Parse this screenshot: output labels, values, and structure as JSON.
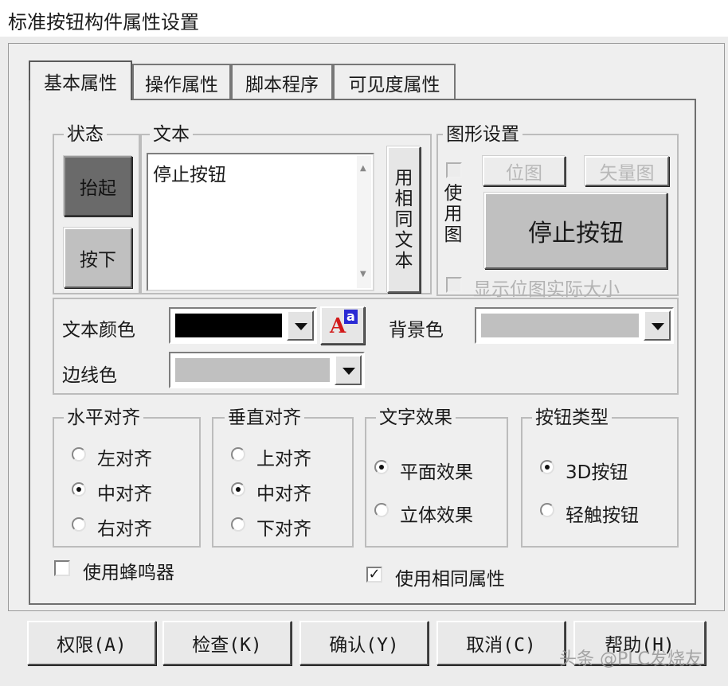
{
  "window": {
    "title": "标准按钮构件属性设置"
  },
  "tabs": [
    "基本属性",
    "操作属性",
    "脚本程序",
    "可见度属性"
  ],
  "state_group": {
    "label": "状态",
    "up": "抬起",
    "down": "按下"
  },
  "text_group": {
    "label": "文本",
    "value": "停止按钮",
    "same_text_button": "用相同文本"
  },
  "graphic_group": {
    "label": "图形设置",
    "use_image": "使用图",
    "bitmap_button": "位图",
    "vector_button": "矢量图",
    "preview_text": "停止按钮",
    "show_actual_size": "显示位图实际大小"
  },
  "colors_section": {
    "text_color_label": "文本颜色",
    "text_color": "#000000",
    "bg_color_label": "背景色",
    "bg_color": "#c0c0c0",
    "border_color_label": "边线色",
    "border_color": "#c0c0c0"
  },
  "h_align": {
    "label": "水平对齐",
    "options": [
      "左对齐",
      "中对齐",
      "右对齐"
    ],
    "selected": 1
  },
  "v_align": {
    "label": "垂直对齐",
    "options": [
      "上对齐",
      "中对齐",
      "下对齐"
    ],
    "selected": 1
  },
  "text_effect": {
    "label": "文字效果",
    "options": [
      "平面效果",
      "立体效果"
    ],
    "selected": 0
  },
  "button_type": {
    "label": "按钮类型",
    "options": [
      "3D按钮",
      "轻触按钮"
    ],
    "selected": 0
  },
  "use_buzzer": {
    "label": "使用蜂鸣器",
    "checked": false
  },
  "use_same_props": {
    "label": "使用相同属性",
    "checked": true
  },
  "bottom_buttons": [
    "权限(A)",
    "检查(K)",
    "确认(Y)",
    "取消(C)",
    "帮助(H)"
  ],
  "watermark": "头条 @PLC发烧友"
}
